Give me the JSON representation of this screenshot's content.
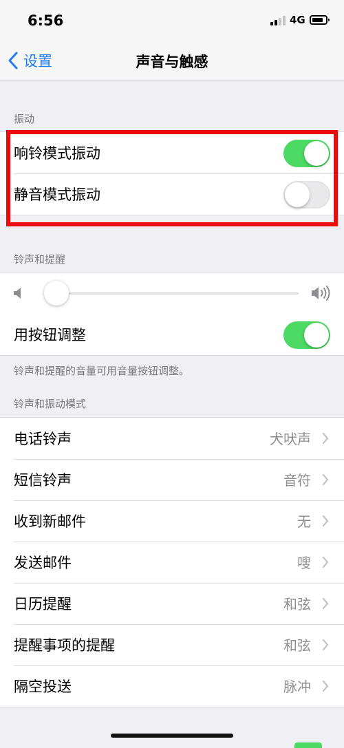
{
  "status_bar": {
    "time": "6:56",
    "network": "4G"
  },
  "nav": {
    "back_label": "设置",
    "title": "声音与触感"
  },
  "vibration": {
    "header": "振动",
    "rows": [
      {
        "label": "响铃模式振动",
        "on": true
      },
      {
        "label": "静音模式振动",
        "on": false
      }
    ]
  },
  "ringer": {
    "header": "铃声和提醒",
    "volume_level": 0.05,
    "adjust_label": "用按钮调整",
    "adjust_on": true,
    "footnote": "铃声和提醒的音量可用音量按钮调整。"
  },
  "patterns": {
    "header": "铃声和振动模式",
    "rows": [
      {
        "label": "电话铃声",
        "value": "犬吠声"
      },
      {
        "label": "短信铃声",
        "value": "音符"
      },
      {
        "label": "收到新邮件",
        "value": "无"
      },
      {
        "label": "发送邮件",
        "value": "嗖"
      },
      {
        "label": "日历提醒",
        "value": "和弦"
      },
      {
        "label": "提醒事项的提醒",
        "value": "和弦"
      },
      {
        "label": "隔空投送",
        "value": "脉冲"
      }
    ]
  },
  "colors": {
    "accent": "#1e7cf2",
    "toggle_on": "#4cd964",
    "highlight": "#ee0a0a"
  },
  "icons": [
    "chevron-left-icon",
    "chevron-right-icon",
    "speaker-low-icon",
    "speaker-high-icon",
    "signal-icon",
    "battery-icon"
  ]
}
